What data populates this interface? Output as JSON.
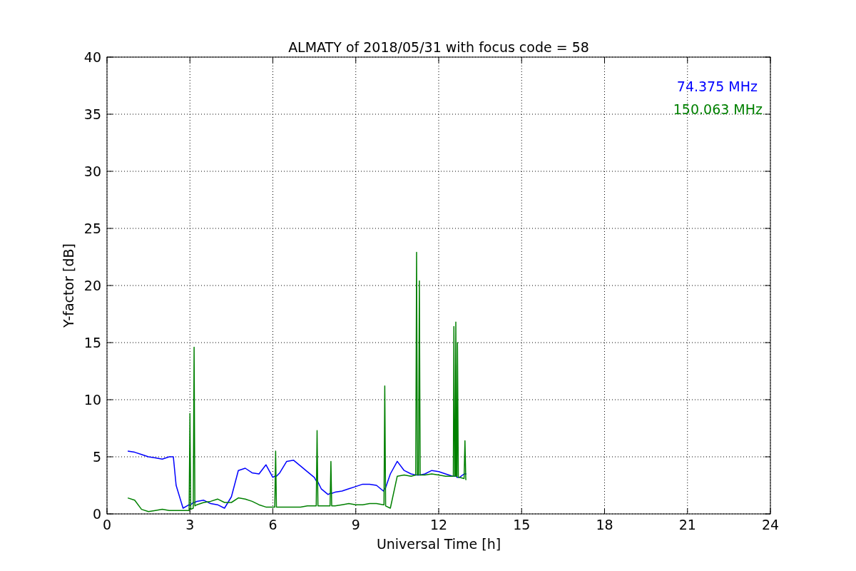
{
  "chart_data": {
    "type": "line",
    "title": "ALMATY of 2018/05/31 with focus code = 58",
    "xlabel": "Universal Time [h]",
    "ylabel": "Y-factor [dB]",
    "grid": true,
    "x": [
      0.75,
      1,
      1.25,
      1.5,
      1.75,
      2,
      2.25,
      2.4,
      2.5,
      2.75,
      2.97,
      3,
      3.03,
      3.12,
      3.15,
      3.18,
      3.25,
      3.5,
      3.75,
      4,
      4.25,
      4.5,
      4.75,
      5,
      5.25,
      5.5,
      5.75,
      6,
      6.07,
      6.1,
      6.13,
      6.25,
      6.5,
      6.75,
      7,
      7.25,
      7.5,
      7.57,
      7.6,
      7.63,
      7.75,
      8,
      8.07,
      8.1,
      8.13,
      8.25,
      8.5,
      8.75,
      9,
      9.25,
      9.5,
      9.75,
      10,
      10.02,
      10.05,
      10.08,
      10.25,
      10.5,
      10.75,
      11,
      11.17,
      11.2,
      11.23,
      11.27,
      11.3,
      11.33,
      11.5,
      11.75,
      12,
      12.25,
      12.5,
      12.53,
      12.55,
      12.58,
      12.6,
      12.62,
      12.64,
      12.66,
      12.68,
      12.71,
      12.75,
      12.92,
      12.95,
      12.98,
      13
    ],
    "series": [
      {
        "name": "74.375 MHz",
        "color": "#0000ff",
        "values": [
          5.5,
          5.4,
          5.2,
          5.0,
          4.9,
          4.8,
          5.0,
          5.0,
          2.5,
          0.5,
          0.8,
          0.8,
          0.8,
          1.0,
          1.0,
          1.0,
          1.1,
          1.2,
          0.9,
          0.8,
          0.5,
          1.5,
          3.8,
          4.0,
          3.6,
          3.5,
          4.3,
          3.2,
          3.3,
          3.3,
          3.3,
          3.6,
          4.6,
          4.7,
          4.2,
          3.7,
          3.2,
          2.9,
          2.9,
          2.8,
          2.2,
          1.7,
          1.8,
          1.8,
          1.8,
          1.9,
          2.0,
          2.2,
          2.4,
          2.6,
          2.6,
          2.5,
          2.0,
          2.1,
          2.2,
          2.3,
          3.5,
          4.6,
          3.8,
          3.5,
          3.4,
          3.4,
          3.4,
          3.4,
          3.4,
          3.4,
          3.5,
          3.8,
          3.7,
          3.5,
          3.3,
          3.3,
          3.3,
          3.3,
          3.3,
          3.3,
          3.3,
          3.2,
          3.2,
          3.2,
          3.2,
          3.5,
          3.5,
          3.5,
          3.5
        ]
      },
      {
        "name": "150.063 MHz",
        "color": "#008000",
        "values": [
          1.4,
          1.2,
          0.4,
          0.2,
          0.3,
          0.4,
          0.3,
          0.3,
          0.3,
          0.3,
          0.3,
          8.8,
          0.4,
          0.5,
          14.6,
          0.7,
          0.8,
          1.0,
          1.1,
          1.3,
          1.0,
          1.0,
          1.4,
          1.3,
          1.1,
          0.8,
          0.6,
          0.6,
          0.6,
          5.5,
          0.6,
          0.6,
          0.6,
          0.6,
          0.6,
          0.7,
          0.7,
          0.7,
          7.3,
          0.7,
          0.7,
          0.7,
          0.7,
          4.6,
          0.7,
          0.7,
          0.8,
          0.9,
          0.8,
          0.8,
          0.9,
          0.9,
          0.8,
          0.8,
          11.2,
          0.7,
          0.5,
          3.3,
          3.4,
          3.3,
          3.4,
          22.9,
          3.4,
          3.4,
          20.4,
          3.4,
          3.4,
          3.5,
          3.4,
          3.3,
          3.3,
          3.3,
          16.4,
          3.3,
          3.3,
          16.8,
          3.3,
          3.3,
          15.0,
          3.2,
          3.2,
          3.1,
          6.4,
          3.0,
          3.0
        ]
      }
    ],
    "xlim": [
      0,
      24
    ],
    "ylim": [
      0,
      40
    ],
    "xticks": [
      0,
      3,
      6,
      9,
      12,
      15,
      18,
      21,
      24
    ],
    "yticks": [
      0,
      5,
      10,
      15,
      20,
      25,
      30,
      35,
      40
    ]
  }
}
